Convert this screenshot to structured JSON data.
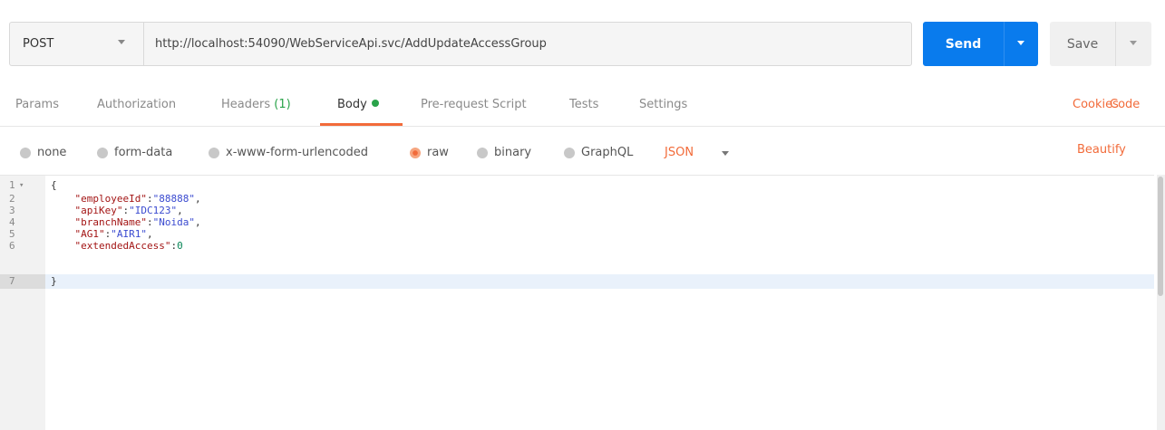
{
  "request": {
    "method": "POST",
    "url": "http://localhost:54090/WebServiceApi.svc/AddUpdateAccessGroup"
  },
  "actions": {
    "send_label": "Send",
    "save_label": "Save"
  },
  "tabs": [
    {
      "label": "Params"
    },
    {
      "label": "Authorization"
    },
    {
      "label": "Headers",
      "count": "(1)"
    },
    {
      "label": "Body",
      "active": true
    },
    {
      "label": "Pre-request Script"
    },
    {
      "label": "Tests"
    },
    {
      "label": "Settings"
    }
  ],
  "links": {
    "cookies": "Cookies",
    "code": "Code"
  },
  "body_types": [
    {
      "label": "none"
    },
    {
      "label": "form-data"
    },
    {
      "label": "x-www-form-urlencoded"
    },
    {
      "label": "raw",
      "selected": true
    },
    {
      "label": "binary"
    },
    {
      "label": "GraphQL"
    }
  ],
  "format": "JSON",
  "beautify_label": "Beautify",
  "editor": {
    "lines": [
      {
        "n": "1",
        "text": "{"
      },
      {
        "n": "2",
        "text": "    \"employeeId\":\"88888\","
      },
      {
        "n": "3",
        "text": "    \"apiKey\":\"IDC123\","
      },
      {
        "n": "4",
        "text": "    \"branchName\":\"Noida\","
      },
      {
        "n": "5",
        "text": "    \"AG1\":\"AIR1\","
      },
      {
        "n": "6",
        "text": "    \"extendedAccess\":0"
      },
      {
        "n": "7",
        "text": "}"
      }
    ]
  },
  "colors": {
    "accent": "#f26b3a",
    "send": "#097bed",
    "dot": "#2aa34a"
  }
}
